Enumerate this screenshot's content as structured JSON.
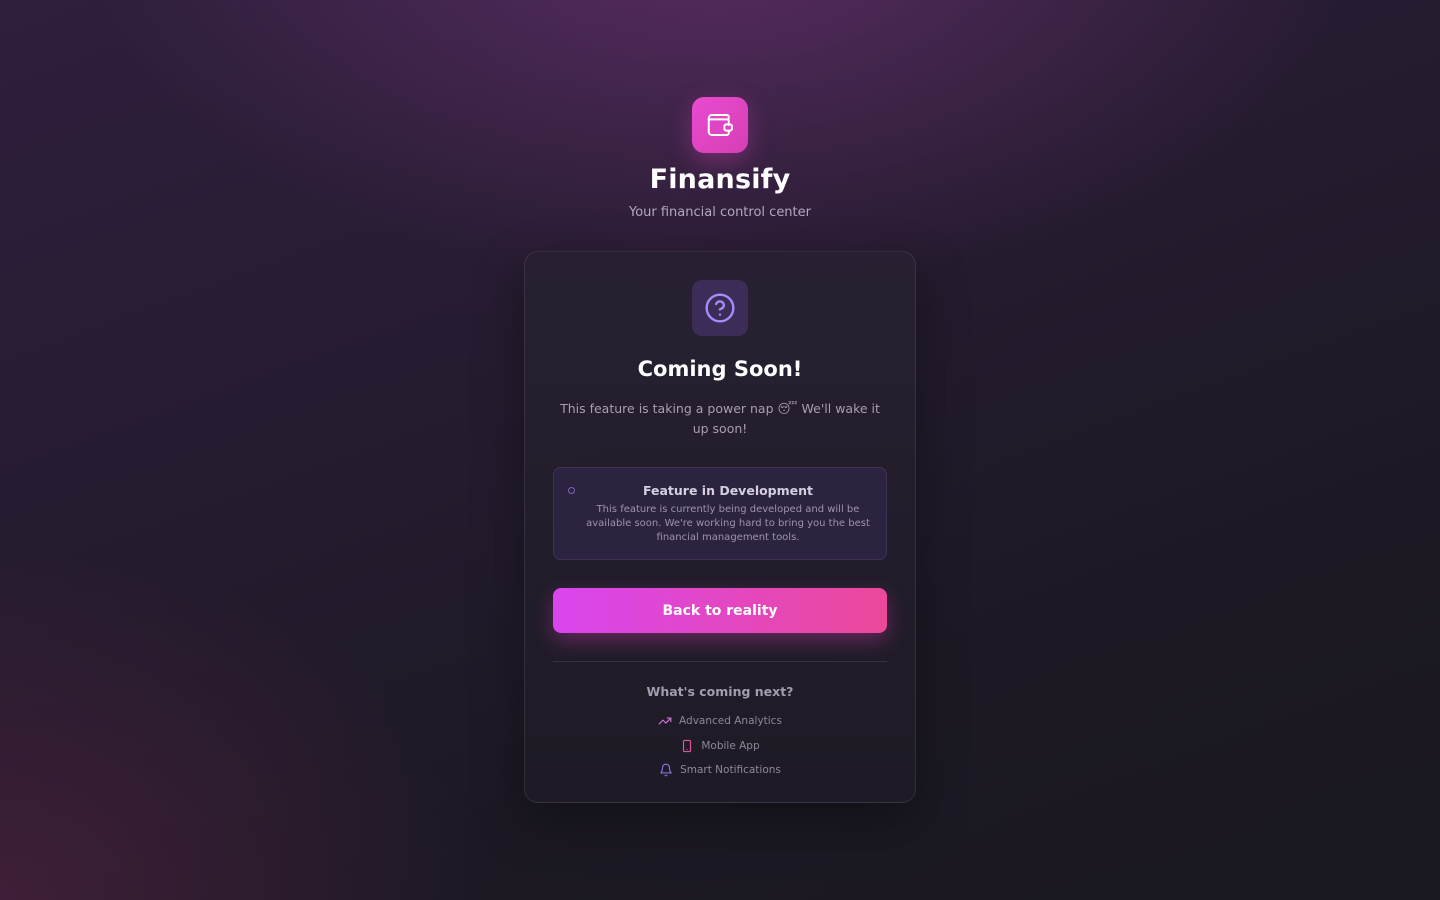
{
  "brand": {
    "name": "Finansify",
    "tagline": "Your financial control center",
    "logo_icon": "wallet-icon",
    "accent": "#e94bd0"
  },
  "card": {
    "icon": "help-circle-icon",
    "title": "Coming Soon!",
    "description": "This feature is taking a power nap 😴 We'll wake it up soon!",
    "info": {
      "title": "Feature in Development",
      "text": "This feature is currently being developed and will be available soon. We're working hard to bring you the best financial management tools."
    },
    "button_label": "Back to reality",
    "button_gradient": [
      "#d946ef",
      "#ec4899"
    ]
  },
  "upcoming": {
    "title": "What's coming next?",
    "items": [
      {
        "label": "Advanced Analytics",
        "icon": "trending-up-icon",
        "color": "#d36fd9"
      },
      {
        "label": "Mobile App",
        "icon": "smartphone-icon",
        "color": "#e0559e"
      },
      {
        "label": "Smart Notifications",
        "icon": "bell-icon",
        "color": "#8b6fd8"
      }
    ]
  }
}
